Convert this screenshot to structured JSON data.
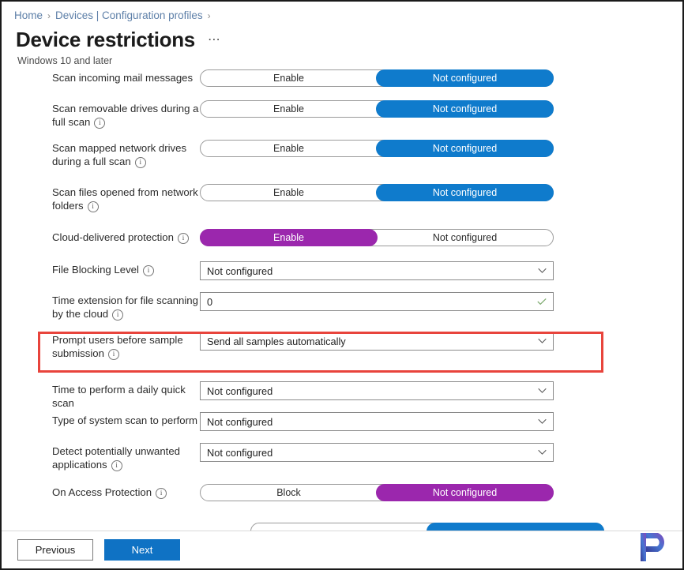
{
  "breadcrumb": {
    "items": [
      {
        "label": "Home"
      },
      {
        "label": "Devices | Configuration profiles"
      }
    ],
    "separator": "›"
  },
  "header": {
    "title": "Device restrictions",
    "ellipsis": "⋯",
    "subtitle": "Windows 10 and later"
  },
  "settings": [
    {
      "label": "Scan incoming mail messages",
      "info": false,
      "type": "toggle",
      "options": [
        "Enable",
        "Not configured"
      ],
      "selected": 1,
      "accent": "blue"
    },
    {
      "label": "Scan removable drives during a full scan",
      "info": true,
      "type": "toggle",
      "options": [
        "Enable",
        "Not configured"
      ],
      "selected": 1,
      "accent": "blue"
    },
    {
      "label": "Scan mapped network drives during a full scan",
      "info": true,
      "type": "toggle",
      "options": [
        "Enable",
        "Not configured"
      ],
      "selected": 1,
      "accent": "blue"
    },
    {
      "label": "Scan files opened from network folders",
      "info": true,
      "type": "toggle",
      "options": [
        "Enable",
        "Not configured"
      ],
      "selected": 1,
      "accent": "blue"
    },
    {
      "label": "Cloud-delivered protection",
      "info": true,
      "type": "toggle",
      "options": [
        "Enable",
        "Not configured"
      ],
      "selected": 0,
      "accent": "purple"
    },
    {
      "label": "File Blocking Level",
      "info": true,
      "type": "dropdown",
      "value": "Not configured"
    },
    {
      "label": "Time extension for file scanning by the cloud",
      "info": true,
      "type": "input",
      "value": "0",
      "valid": true
    },
    {
      "label": "Prompt users before sample submission",
      "info": true,
      "type": "dropdown",
      "value": "Send all samples automatically",
      "highlighted": true
    },
    {
      "label": "Time to perform a daily quick scan",
      "info": false,
      "type": "dropdown",
      "value": "Not configured"
    },
    {
      "label": "Type of system scan to perform",
      "info": false,
      "type": "dropdown",
      "value": "Not configured"
    },
    {
      "label": "Detect potentially unwanted applications",
      "info": true,
      "type": "dropdown",
      "value": "Not configured"
    },
    {
      "label": "On Access Protection",
      "info": true,
      "type": "toggle",
      "options": [
        "Block",
        "Not configured"
      ],
      "selected": 1,
      "accent": "purple"
    }
  ],
  "clipped_row": {
    "options": [
      "",
      ""
    ],
    "selected": 1,
    "accent": "blue"
  },
  "footer": {
    "previous_label": "Previous",
    "next_label": "Next"
  },
  "watermark": {
    "letter": "P"
  },
  "colors": {
    "blue_accent": "#0f7bcc",
    "purple_accent": "#9b27ad",
    "breadcrumb_link": "#5d7fa8",
    "highlight_red": "#e8443c",
    "next_button": "#0f72c4",
    "valid_green": "#7aa86b"
  }
}
